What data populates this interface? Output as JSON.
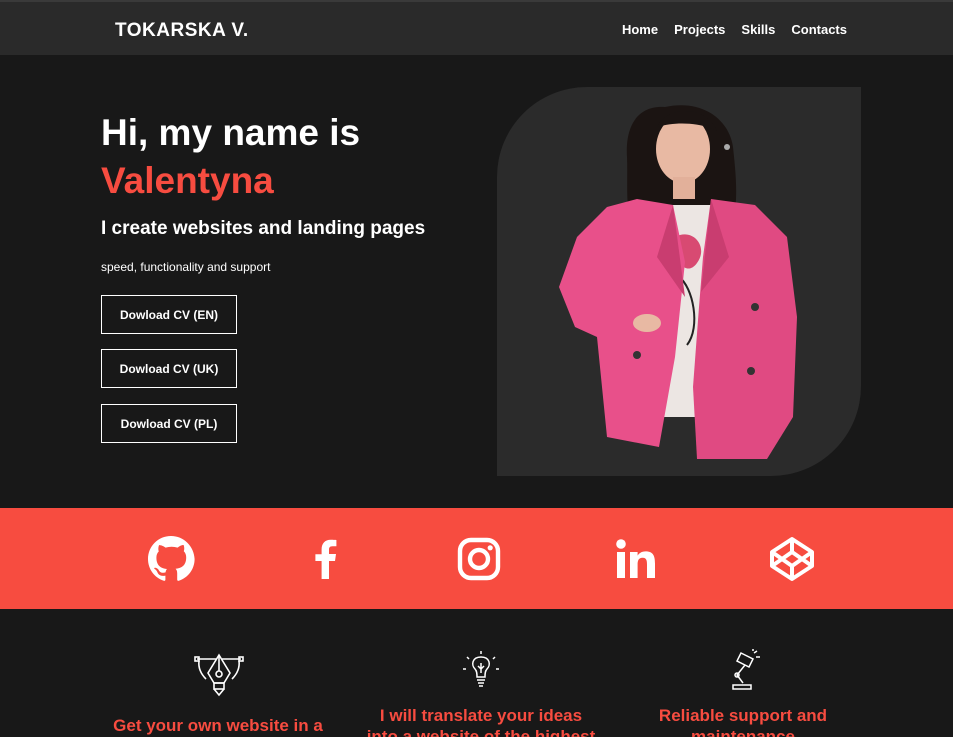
{
  "header": {
    "logo": "TOKARSKA V.",
    "nav": [
      "Home",
      "Projects",
      "Skills",
      "Contacts"
    ]
  },
  "hero": {
    "greeting": "Hi, my name is",
    "name": "Valentyna",
    "subtitle": "I create websites and landing pages",
    "tagline": "speed, functionality and support",
    "buttons": [
      "Dowload CV (EN)",
      "Dowload CV (UK)",
      "Dowload CV (PL)"
    ]
  },
  "social": [
    "github-icon",
    "facebook-icon",
    "instagram-icon",
    "linkedin-icon",
    "codepen-icon"
  ],
  "services": [
    {
      "icon": "pen-tool-icon",
      "title_line1": "Get your own website in a",
      "title_line2": ""
    },
    {
      "icon": "lightbulb-icon",
      "title_line1": "I will translate your ideas",
      "title_line2": "into a website of the highest"
    },
    {
      "icon": "desk-lamp-icon",
      "title_line1": "Reliable support and",
      "title_line2": "maintenance"
    }
  ],
  "colors": {
    "accent": "#f74c40",
    "background": "#181818",
    "header": "#2a2a2a"
  }
}
